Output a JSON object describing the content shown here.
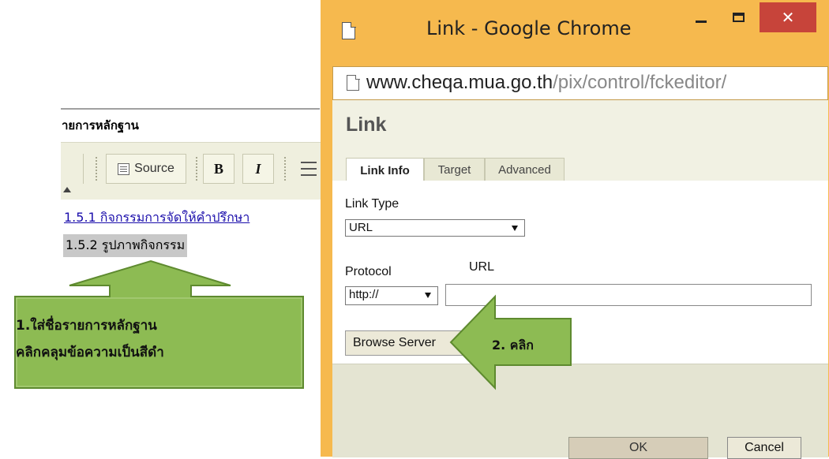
{
  "editor": {
    "title": "ายการหลักฐาน",
    "toolbar": {
      "source_label": "Source",
      "bold_label": "B",
      "italic_label": "I"
    },
    "link_text": "1.5.1  กิจกรรมการจัดให้คำปรึกษา",
    "selected_text": "1.5.2  รูปภาพกิจกรรม"
  },
  "callouts": {
    "step1_line1": "1.ใส่ชื่อรายการหลักฐาน",
    "step1_line2": "คลิกคลุมข้อความเป็นสีดำ",
    "step2": "2. คลิก",
    "fill_color": "#8dbb53",
    "border_color": "#5e8a2f"
  },
  "window": {
    "title": "Link - Google Chrome",
    "close_glyph": "✕",
    "address_host": "www.cheqa.mua.go.th",
    "address_path": "/pix/control/fckeditor/",
    "frame_color": "#f6b94e",
    "close_color": "#c7443a"
  },
  "dialog": {
    "title": "Link",
    "tabs": [
      {
        "label": "Link Info",
        "active": true
      },
      {
        "label": "Target",
        "active": false
      },
      {
        "label": "Advanced",
        "active": false
      }
    ],
    "link_type_label": "Link Type",
    "link_type_value": "URL",
    "protocol_label": "Protocol",
    "protocol_value": "http://",
    "url_label": "URL",
    "url_value": "",
    "browse_label": "Browse Server",
    "ok_label": "OK",
    "cancel_label": "Cancel"
  }
}
